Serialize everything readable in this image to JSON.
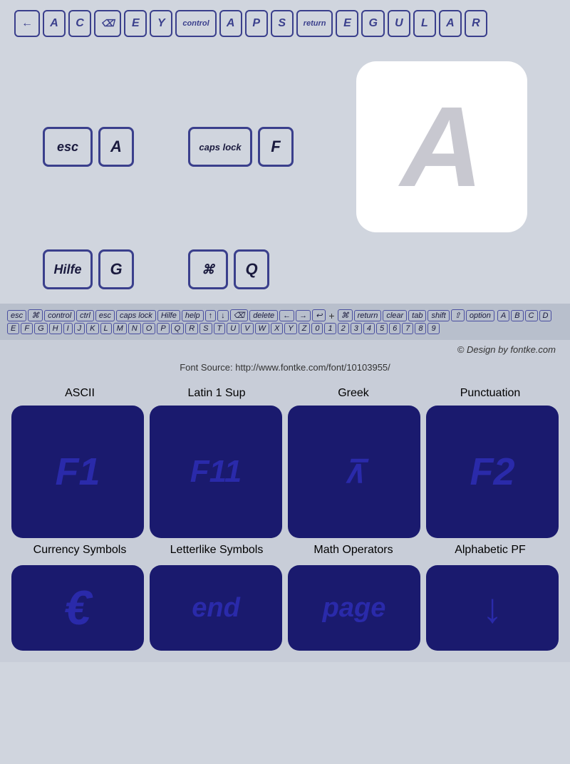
{
  "topNav": {
    "keys": [
      {
        "label": "←",
        "type": "arrow"
      },
      {
        "label": "A",
        "type": "letter"
      },
      {
        "label": "C",
        "type": "letter"
      },
      {
        "label": "⌫",
        "type": "icon"
      },
      {
        "label": "E",
        "type": "letter"
      },
      {
        "label": "Y",
        "type": "letter"
      },
      {
        "label": "control",
        "type": "word"
      },
      {
        "label": "A",
        "type": "letter"
      },
      {
        "label": "P",
        "type": "letter"
      },
      {
        "label": "S",
        "type": "letter"
      },
      {
        "label": "return",
        "type": "word"
      },
      {
        "label": "E",
        "type": "letter"
      },
      {
        "label": "G",
        "type": "letter"
      },
      {
        "label": "U",
        "type": "letter"
      },
      {
        "label": "L",
        "type": "letter"
      },
      {
        "label": "A",
        "type": "letter"
      },
      {
        "label": "R",
        "type": "letter"
      }
    ]
  },
  "preview": {
    "row1": [
      {
        "label": "esc",
        "type": "word"
      },
      {
        "label": "A",
        "type": "letter"
      }
    ],
    "row1right": [
      {
        "label": "caps lock",
        "type": "word"
      },
      {
        "label": "F",
        "type": "letter"
      }
    ],
    "bigLetter": "A",
    "row2": [
      {
        "label": "Hilfe",
        "type": "word"
      },
      {
        "label": "G",
        "type": "letter"
      }
    ],
    "row2right": [
      {
        "label": "⌘",
        "type": "icon"
      },
      {
        "label": "Q",
        "type": "letter"
      }
    ]
  },
  "glyphs": {
    "items": [
      "esc",
      "⌘",
      "control",
      "ctrl",
      "esc",
      "caps lock",
      "Hilfe",
      "help",
      "↑",
      "↓",
      "⌫",
      "delete",
      "←",
      "→",
      "↩",
      "+",
      "⌘",
      "return",
      "clear",
      "tab",
      "shift",
      "⇧",
      "option"
    ],
    "letters": [
      "A",
      "B",
      "C",
      "D",
      "E",
      "F",
      "G",
      "H",
      "I",
      "J",
      "K",
      "L",
      "M",
      "N",
      "O",
      "P",
      "Q",
      "R",
      "S",
      "T",
      "U",
      "V",
      "W",
      "X",
      "Y",
      "Z"
    ],
    "digits": [
      "0",
      "1",
      "2",
      "3",
      "4",
      "5",
      "6",
      "7",
      "8",
      "9"
    ],
    "divider": "+"
  },
  "footer": {
    "credit": "© Design by fontke.com",
    "source": "Font Source: http://www.fontke.com/font/10103955/"
  },
  "categories": {
    "row1": [
      {
        "label": "ASCII",
        "icon": "F1",
        "sublabel": "Currency Symbols"
      },
      {
        "label": "Latin 1 Sup",
        "icon": "F11",
        "sublabel": "Letterlike Symbols"
      },
      {
        "label": "Greek",
        "icon": "⊼",
        "sublabel": "Math Operators"
      },
      {
        "label": "Punctuation",
        "icon": "F2",
        "sublabel": "Alphabetic PF"
      }
    ],
    "row2": [
      {
        "label": "",
        "icon": "€",
        "sublabel": ""
      },
      {
        "label": "",
        "icon": "end",
        "sublabel": ""
      },
      {
        "label": "",
        "icon": "page",
        "sublabel": ""
      },
      {
        "label": "",
        "icon": "↓",
        "sublabel": ""
      }
    ]
  }
}
